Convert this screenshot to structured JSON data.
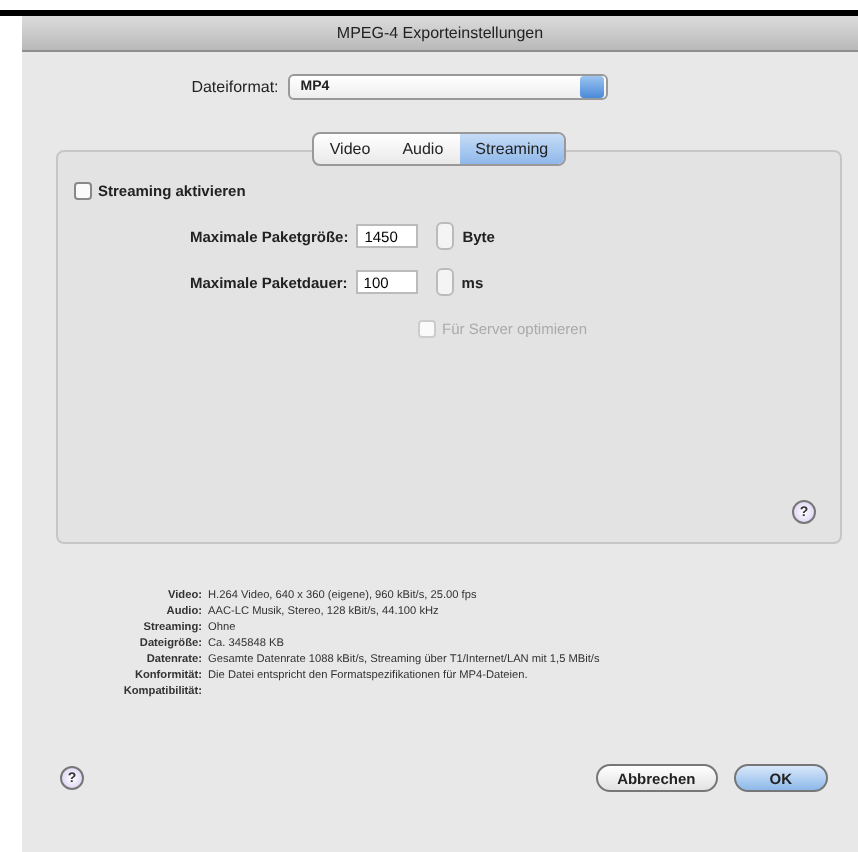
{
  "window": {
    "title": "MPEG-4 Exporteinstellungen"
  },
  "file_format": {
    "label": "Dateiformat:",
    "value": "MP4"
  },
  "tabs": [
    {
      "label": "Video",
      "selected": false
    },
    {
      "label": "Audio",
      "selected": false
    },
    {
      "label": "Streaming",
      "selected": true
    }
  ],
  "streaming_enable": {
    "label": "Streaming aktivieren",
    "checked": false,
    "disabled": false
  },
  "fields": [
    {
      "label": "Maximale Paketgröße:",
      "value": "1450",
      "unit": "Byte"
    },
    {
      "label": "Maximale Paketdauer:",
      "value": "100",
      "unit": "ms"
    }
  ],
  "server_optimize": {
    "label": "Für Server optimieren",
    "checked": false,
    "disabled": true
  },
  "summary": [
    {
      "label": "Video:",
      "value": "H.264 Video, 640 x 360 (eigene), 960 kBit/s, 25.00 fps"
    },
    {
      "label": "Audio:",
      "value": "AAC-LC Musik, Stereo, 128 kBit/s, 44.100 kHz"
    },
    {
      "label": "Streaming:",
      "value": "Ohne"
    },
    {
      "label": "Dateigröße:",
      "value": "Ca. 345848 KB"
    },
    {
      "label": "Datenrate:",
      "value": "Gesamte Datenrate 1088 kBit/s, Streaming über T1/Internet/LAN mit 1,5 MBit/s"
    },
    {
      "label": "Konformität:",
      "value": "Die Datei entspricht den Formatspezifikationen für MP4-Dateien."
    },
    {
      "label": "Kompatibilität:"
    }
  ],
  "help_buttons": [
    {
      "label": "?"
    },
    {
      "label": "?"
    }
  ],
  "buttons": [
    {
      "label": "Abbrechen",
      "default": false
    },
    {
      "label": "OK",
      "default": true
    }
  ]
}
